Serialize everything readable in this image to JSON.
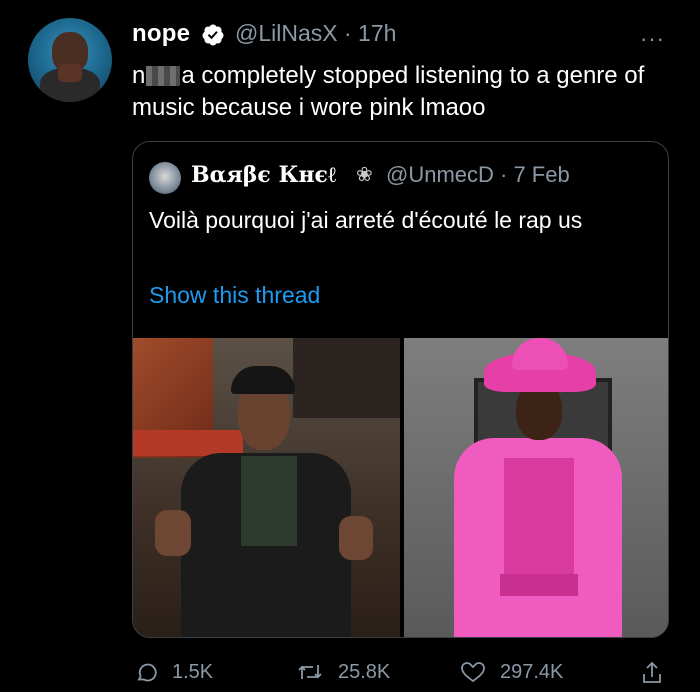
{
  "tweet": {
    "display_name": "nope",
    "handle_time": "@LilNasX · 17h",
    "more_label": "···",
    "text_start": "n",
    "text_rest": "a completely stopped listening to a genre of music because i wore pink lmaoo"
  },
  "quoted": {
    "display_name": "Βαяβє Кнєℓ",
    "flower": "❀",
    "handle_date": "@UnmecD · 7 Feb",
    "text": "Voilà pourquoi j'ai arreté d'écouté le rap us",
    "show_thread": "Show this thread"
  },
  "actions": {
    "reply_count": "1.5K",
    "retweet_count": "25.8K",
    "like_count": "297.4K"
  },
  "colors": {
    "background": "#000000",
    "link": "#1d9bf0",
    "secondary_text": "#8b98a5",
    "verified_badge": "#ffffff"
  },
  "icons": [
    "verified-badge-icon",
    "more-icon",
    "reply-icon",
    "retweet-icon",
    "like-icon",
    "share-icon",
    "flower-icon"
  ]
}
